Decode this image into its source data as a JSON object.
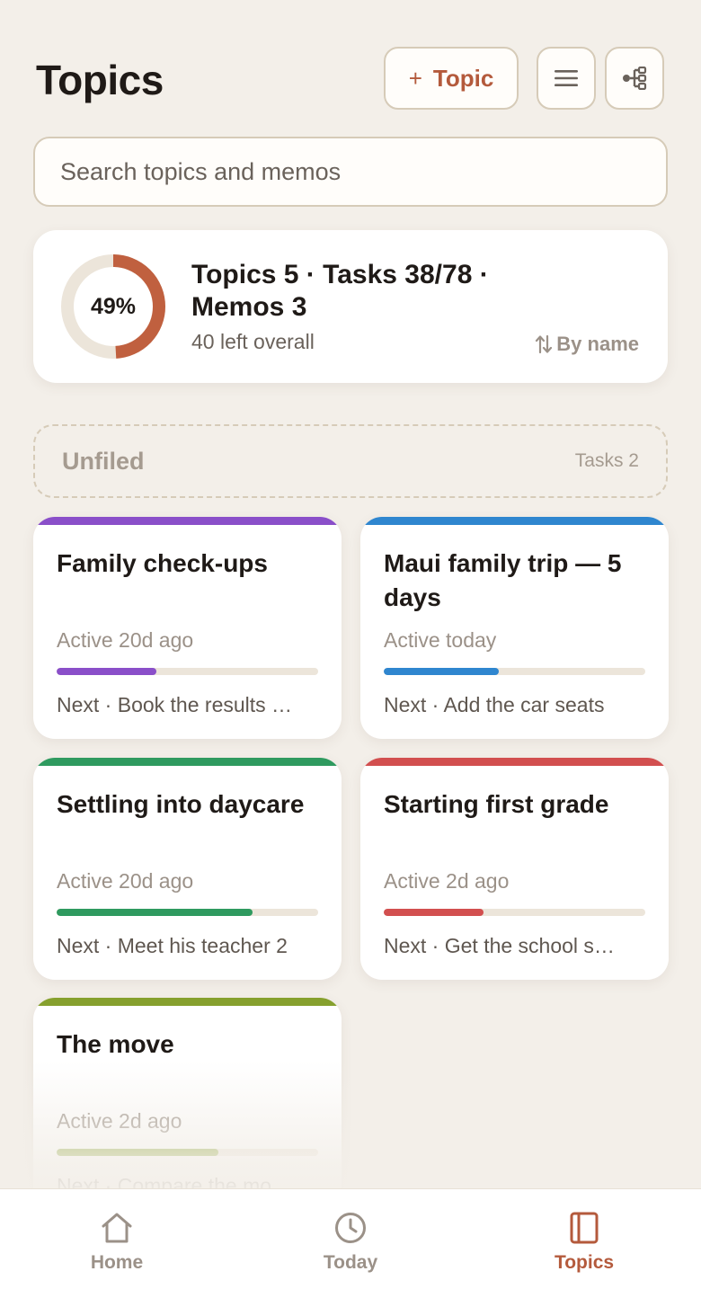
{
  "header": {
    "title": "Topics",
    "add_topic_plus": "+",
    "add_topic_label": "Topic",
    "menu_icon": "hamburger-icon",
    "tree_icon": "tree-hierarchy-icon"
  },
  "search": {
    "placeholder": "Search topics and memos",
    "value": ""
  },
  "summary": {
    "percent_value": 49,
    "percent_label": "49%",
    "stats": "Topics 5 · Tasks 38/78 · Memos 3",
    "left_overall": "40 left overall",
    "sort_label": "By name",
    "sort_icon": "sort-arrows-icon"
  },
  "unfiled": {
    "title": "Unfiled",
    "count": "Tasks 2"
  },
  "topics": [
    {
      "title": "Family check-ups",
      "active": "Active 20d ago",
      "progress": 0.38,
      "next": "Next · Book the results …",
      "color": "#8a4fc9"
    },
    {
      "title": "Maui family trip — 5 days",
      "active": "Active today",
      "progress": 0.44,
      "next": "Next · Add the car seats",
      "color": "#2f86cf"
    },
    {
      "title": "Settling into daycare",
      "active": "Active 20d ago",
      "progress": 0.75,
      "next": "Next · Meet his teacher 2",
      "color": "#2f9a5f"
    },
    {
      "title": "Starting first grade",
      "active": "Active 2d ago",
      "progress": 0.38,
      "next": "Next · Get the school s…",
      "color": "#d24f4f"
    },
    {
      "title": "The move",
      "active": "Active 2d ago",
      "progress": 0.62,
      "next": "Next · Compare the mo…",
      "color": "#86a02e"
    }
  ],
  "tabs": [
    {
      "label": "Home",
      "icon": "home-icon"
    },
    {
      "label": "Today",
      "icon": "clock-icon"
    },
    {
      "label": "Topics",
      "icon": "notebook-icon"
    }
  ],
  "colors": {
    "accent": "#b45a3c",
    "background": "#f3efe9",
    "donut_track": "#ece5da",
    "donut_fill": "#c0603f"
  }
}
